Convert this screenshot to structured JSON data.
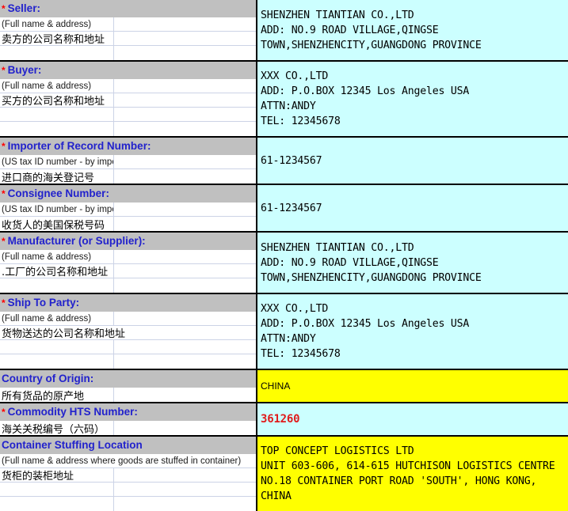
{
  "form": {
    "colors": {
      "header_bg": "#c0c0c0",
      "value_bg_cyan": "#ccffff",
      "value_bg_yellow": "#ffff00",
      "title_text": "#2222cc",
      "required_star": "#ff0000",
      "hts_value_text": "#e01b1b"
    },
    "required_marker": "*",
    "sections": [
      {
        "id": "seller",
        "title": "Seller:",
        "required": true,
        "english_hint": "(Full name & address)",
        "chinese_label": "卖方的公司名称和地址",
        "extra_rows": 1,
        "value_bg": "cyan",
        "value_font": "mono",
        "value_lines": [
          "SHENZHEN TIANTIAN CO.,LTD",
          "ADD: NO.9 ROAD VILLAGE,QINGSE",
          "TOWN,SHENZHENCITY,GUANGDONG PROVINCE"
        ]
      },
      {
        "id": "buyer",
        "title": "Buyer:",
        "required": true,
        "english_hint": "(Full name & address)",
        "chinese_label": "买方的公司名称和地址",
        "extra_rows": 2,
        "value_bg": "cyan",
        "value_font": "mono",
        "value_lines": [
          "XXX CO.,LTD",
          "ADD: P.O.BOX 12345 Los Angeles USA",
          "ATTN:ANDY",
          "TEL: 12345678"
        ]
      },
      {
        "id": "importer-of-record-number",
        "title": "Importer of Record Number:",
        "required": true,
        "english_hint": "(US tax ID number - by importer)",
        "chinese_label": "进口商的海关登记号",
        "extra_rows": 0,
        "value_bg": "cyan",
        "value_font": "mono",
        "value_lines": [
          "61-1234567"
        ]
      },
      {
        "id": "consignee-number",
        "title": "Consignee Number:",
        "required": true,
        "english_hint": "(US tax ID number - by importer)",
        "chinese_label": "收货人的美国保税号码",
        "extra_rows": 0,
        "value_bg": "cyan",
        "value_font": "mono",
        "value_lines": [
          "61-1234567"
        ]
      },
      {
        "id": "manufacturer-or-supplier",
        "title": "Manufacturer (or Supplier):",
        "required": true,
        "english_hint": "(Full name & address)",
        "chinese_label": ".工厂的公司名称和地址",
        "extra_rows": 1,
        "value_bg": "cyan",
        "value_font": "mono",
        "value_lines": [
          "SHENZHEN TIANTIAN CO.,LTD",
          "ADD: NO.9 ROAD VILLAGE,QINGSE",
          "TOWN,SHENZHENCITY,GUANGDONG PROVINCE"
        ]
      },
      {
        "id": "ship-to-party",
        "title": "Ship To Party:",
        "required": true,
        "english_hint": "(Full name & address)",
        "chinese_label": "货物送达的公司名称和地址",
        "chinese_spans": true,
        "extra_rows": 2,
        "value_bg": "cyan",
        "value_font": "mono",
        "value_lines": [
          "XXX CO.,LTD",
          "ADD: P.O.BOX 12345 Los Angeles USA",
          "ATTN:ANDY",
          "TEL: 12345678"
        ]
      },
      {
        "id": "country-of-origin",
        "title": "Country of Origin:",
        "required": false,
        "english_hint": null,
        "chinese_label": "所有货品的原产地",
        "extra_rows": 0,
        "value_bg": "yellow",
        "value_font": "sans",
        "value_lines": [
          "CHINA"
        ]
      },
      {
        "id": "commodity-hts-number",
        "title": "Commodity HTS Number:",
        "required": true,
        "english_hint": null,
        "chinese_label": "海关关税编号（六码）",
        "extra_rows": 0,
        "value_bg": "cyan",
        "value_font": "mono-red",
        "value_lines": [
          "361260"
        ]
      },
      {
        "id": "container-stuffing-location",
        "title": "Container Stuffing Location",
        "required": false,
        "english_hint": "(Full name & address where goods are stuffed in container)",
        "hint_spans": true,
        "chinese_label": "货柜的装柜地址",
        "extra_rows": 2,
        "value_bg": "yellow",
        "value_font": "mono",
        "value_lines": [
          "TOP CONCEPT LOGISTICS LTD",
          "UNIT 603-606, 614-615 HUTCHISON LOGISTICS CENTRE",
          "NO.18 CONTAINER PORT ROAD 'SOUTH', HONG KONG,",
          "CHINA"
        ]
      }
    ]
  }
}
